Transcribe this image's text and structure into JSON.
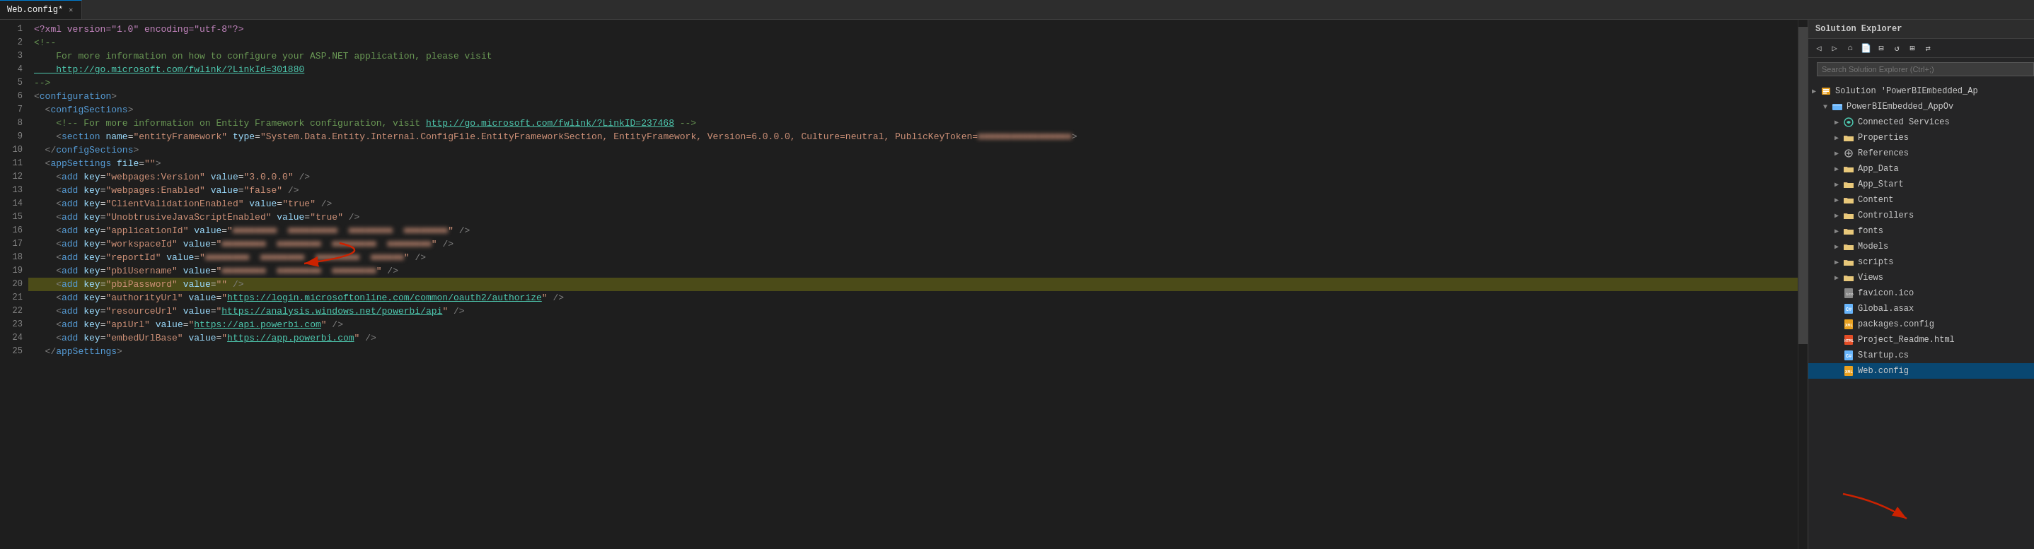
{
  "tab": {
    "label": "Web.config*",
    "modified": true
  },
  "editor": {
    "lines": [
      {
        "num": 1,
        "tokens": [
          {
            "t": "pi",
            "v": "<?xml version=\"1.0\" encoding=\"utf-8\"?>"
          }
        ]
      },
      {
        "num": 2,
        "tokens": [
          {
            "t": "comment",
            "v": "<!--"
          }
        ]
      },
      {
        "num": 3,
        "tokens": [
          {
            "t": "comment",
            "v": "    For more information on how to configure your ASP.NET application, please visit"
          }
        ]
      },
      {
        "num": 4,
        "tokens": [
          {
            "t": "link",
            "v": "    http://go.microsoft.com/fwlink/?LinkId=301880"
          }
        ]
      },
      {
        "num": 5,
        "tokens": [
          {
            "t": "comment",
            "v": "-->"
          }
        ]
      },
      {
        "num": 6,
        "tokens": [
          {
            "t": "bracket",
            "v": "<"
          },
          {
            "t": "tag",
            "v": "configuration"
          },
          {
            "t": "bracket",
            "v": ">"
          }
        ]
      },
      {
        "num": 7,
        "tokens": [
          {
            "t": "bracket",
            "v": "  <"
          },
          {
            "t": "tag",
            "v": "configSections"
          },
          {
            "t": "bracket",
            "v": ">"
          }
        ]
      },
      {
        "num": 8,
        "tokens": [
          {
            "t": "comment",
            "v": "    <!-- For more information on Entity Framework configuration, visit "
          },
          {
            "t": "link",
            "v": "http://go.microsoft.com/fwlink/?LinkID=237468"
          },
          {
            "t": "comment",
            "v": " -->"
          }
        ]
      },
      {
        "num": 9,
        "tokens": [
          {
            "t": "bracket",
            "v": "    <"
          },
          {
            "t": "tag",
            "v": "section"
          },
          {
            "t": "attr",
            "v": " name"
          },
          {
            "t": "eq",
            "v": "="
          },
          {
            "t": "val",
            "v": "\"entityFramework\""
          },
          {
            "t": "attr",
            "v": " type"
          },
          {
            "t": "eq",
            "v": "="
          },
          {
            "t": "val",
            "v": "\"System.Data.Entity.Internal.ConfigFile.EntityFrameworkSection, EntityFramework, Version=6.0.0.0, Culture=neutral, PublicKeyToken="
          },
          {
            "t": "blurred",
            "v": "■■■■■■■■■■■■■■■■■"
          },
          {
            "t": "bracket",
            "v": ">"
          }
        ]
      },
      {
        "num": 10,
        "tokens": [
          {
            "t": "bracket",
            "v": "  </"
          },
          {
            "t": "tag",
            "v": "configSections"
          },
          {
            "t": "bracket",
            "v": ">"
          }
        ]
      },
      {
        "num": 11,
        "tokens": [
          {
            "t": "bracket",
            "v": "  <"
          },
          {
            "t": "tag",
            "v": "appSettings"
          },
          {
            "t": "attr",
            "v": " file"
          },
          {
            "t": "eq",
            "v": "="
          },
          {
            "t": "val",
            "v": "\"\""
          },
          {
            "t": "bracket",
            "v": ">"
          }
        ]
      },
      {
        "num": 12,
        "tokens": [
          {
            "t": "bracket",
            "v": "    <"
          },
          {
            "t": "tag",
            "v": "add"
          },
          {
            "t": "attr",
            "v": " key"
          },
          {
            "t": "eq",
            "v": "="
          },
          {
            "t": "val",
            "v": "\"webpages:Version\""
          },
          {
            "t": "attr",
            "v": " value"
          },
          {
            "t": "eq",
            "v": "="
          },
          {
            "t": "val",
            "v": "\"3.0.0.0\""
          },
          {
            "t": "bracket",
            "v": " />"
          }
        ]
      },
      {
        "num": 13,
        "tokens": [
          {
            "t": "bracket",
            "v": "    <"
          },
          {
            "t": "tag",
            "v": "add"
          },
          {
            "t": "attr",
            "v": " key"
          },
          {
            "t": "eq",
            "v": "="
          },
          {
            "t": "val",
            "v": "\"webpages:Enabled\""
          },
          {
            "t": "attr",
            "v": " value"
          },
          {
            "t": "eq",
            "v": "="
          },
          {
            "t": "val",
            "v": "\"false\""
          },
          {
            "t": "bracket",
            "v": " />"
          }
        ]
      },
      {
        "num": 14,
        "tokens": [
          {
            "t": "bracket",
            "v": "    <"
          },
          {
            "t": "tag",
            "v": "add"
          },
          {
            "t": "attr",
            "v": " key"
          },
          {
            "t": "eq",
            "v": "="
          },
          {
            "t": "val",
            "v": "\"ClientValidationEnabled\""
          },
          {
            "t": "attr",
            "v": " value"
          },
          {
            "t": "eq",
            "v": "="
          },
          {
            "t": "val",
            "v": "\"true\""
          },
          {
            "t": "bracket",
            "v": " />"
          }
        ]
      },
      {
        "num": 15,
        "tokens": [
          {
            "t": "bracket",
            "v": "    <"
          },
          {
            "t": "tag",
            "v": "add"
          },
          {
            "t": "attr",
            "v": " key"
          },
          {
            "t": "eq",
            "v": "="
          },
          {
            "t": "val",
            "v": "\"UnobtrusiveJavaScriptEnabled\""
          },
          {
            "t": "attr",
            "v": " value"
          },
          {
            "t": "eq",
            "v": "="
          },
          {
            "t": "val",
            "v": "\"true\""
          },
          {
            "t": "bracket",
            "v": " />"
          }
        ]
      },
      {
        "num": 16,
        "tokens": [
          {
            "t": "bracket",
            "v": "    <"
          },
          {
            "t": "tag",
            "v": "add"
          },
          {
            "t": "attr",
            "v": " key"
          },
          {
            "t": "eq",
            "v": "="
          },
          {
            "t": "val",
            "v": "\"applicationId\""
          },
          {
            "t": "attr",
            "v": " value"
          },
          {
            "t": "eq",
            "v": "="
          },
          {
            "t": "val",
            "v": "\""
          },
          {
            "t": "blurred",
            "v": "■■■■■■■■  ■■■■■■■■■  ■■■■■■■■  ■■■■■■■■"
          },
          {
            "t": "val",
            "v": "\""
          },
          {
            "t": "bracket",
            "v": " />"
          }
        ]
      },
      {
        "num": 17,
        "tokens": [
          {
            "t": "bracket",
            "v": "    <"
          },
          {
            "t": "tag",
            "v": "add"
          },
          {
            "t": "attr",
            "v": " key"
          },
          {
            "t": "eq",
            "v": "="
          },
          {
            "t": "val",
            "v": "\"workspaceId\""
          },
          {
            "t": "attr",
            "v": " value"
          },
          {
            "t": "eq",
            "v": "="
          },
          {
            "t": "val",
            "v": "\""
          },
          {
            "t": "blurred",
            "v": "■■■■■■■■  ■■■■■■■■  ■■■■■■■■  ■■■■■■■■"
          },
          {
            "t": "val",
            "v": "\""
          },
          {
            "t": "bracket",
            "v": " />"
          }
        ]
      },
      {
        "num": 18,
        "tokens": [
          {
            "t": "bracket",
            "v": "    <"
          },
          {
            "t": "tag",
            "v": "add"
          },
          {
            "t": "attr",
            "v": " key"
          },
          {
            "t": "eq",
            "v": "="
          },
          {
            "t": "val",
            "v": "\"reportId\""
          },
          {
            "t": "attr",
            "v": " value"
          },
          {
            "t": "eq",
            "v": "="
          },
          {
            "t": "val",
            "v": "\""
          },
          {
            "t": "blurred",
            "v": "■■■■■■■■  ■■■■■■■■  ■■■■■■■■  ■■■■■■"
          },
          {
            "t": "val",
            "v": "\""
          },
          {
            "t": "bracket",
            "v": " />"
          }
        ]
      },
      {
        "num": 19,
        "tokens": [
          {
            "t": "bracket",
            "v": "    <"
          },
          {
            "t": "tag",
            "v": "add"
          },
          {
            "t": "attr",
            "v": " key"
          },
          {
            "t": "eq",
            "v": "="
          },
          {
            "t": "val",
            "v": "\"pbiUsername\""
          },
          {
            "t": "attr",
            "v": " value"
          },
          {
            "t": "eq",
            "v": "="
          },
          {
            "t": "val",
            "v": "\""
          },
          {
            "t": "blurred",
            "v": "■■■■■■■■  ■■■■■■■■  ■■■■■■■■"
          },
          {
            "t": "val",
            "v": "\""
          },
          {
            "t": "bracket",
            "v": " />"
          }
        ]
      },
      {
        "num": 20,
        "tokens": [
          {
            "t": "bracket",
            "v": "    <"
          },
          {
            "t": "tag",
            "v": "add"
          },
          {
            "t": "attr",
            "v": " key"
          },
          {
            "t": "eq",
            "v": "="
          },
          {
            "t": "val",
            "v": "\"pbiPassword\""
          },
          {
            "t": "attr",
            "v": " value"
          },
          {
            "t": "eq",
            "v": "="
          },
          {
            "t": "val",
            "v": "\"\""
          },
          {
            "t": "bracket",
            "v": " />"
          }
        ],
        "yellow": true
      },
      {
        "num": 21,
        "tokens": [
          {
            "t": "bracket",
            "v": "    <"
          },
          {
            "t": "tag",
            "v": "add"
          },
          {
            "t": "attr",
            "v": " key"
          },
          {
            "t": "eq",
            "v": "="
          },
          {
            "t": "val",
            "v": "\"authorityUrl\""
          },
          {
            "t": "attr",
            "v": " value"
          },
          {
            "t": "eq",
            "v": "="
          },
          {
            "t": "val",
            "v": "\""
          },
          {
            "t": "link",
            "v": "https://login.microsoftonline.com/common/oauth2/authorize"
          },
          {
            "t": "val",
            "v": "\""
          },
          {
            "t": "bracket",
            "v": " />"
          }
        ]
      },
      {
        "num": 22,
        "tokens": [
          {
            "t": "bracket",
            "v": "    <"
          },
          {
            "t": "tag",
            "v": "add"
          },
          {
            "t": "attr",
            "v": " key"
          },
          {
            "t": "eq",
            "v": "="
          },
          {
            "t": "val",
            "v": "\"resourceUrl\""
          },
          {
            "t": "attr",
            "v": " value"
          },
          {
            "t": "eq",
            "v": "="
          },
          {
            "t": "val",
            "v": "\""
          },
          {
            "t": "link",
            "v": "https://analysis.windows.net/powerbi/api"
          },
          {
            "t": "val",
            "v": "\""
          },
          {
            "t": "bracket",
            "v": " />"
          }
        ]
      },
      {
        "num": 23,
        "tokens": [
          {
            "t": "bracket",
            "v": "    <"
          },
          {
            "t": "tag",
            "v": "add"
          },
          {
            "t": "attr",
            "v": " key"
          },
          {
            "t": "eq",
            "v": "="
          },
          {
            "t": "val",
            "v": "\"apiUrl\""
          },
          {
            "t": "attr",
            "v": " value"
          },
          {
            "t": "eq",
            "v": "="
          },
          {
            "t": "val",
            "v": "\""
          },
          {
            "t": "link",
            "v": "https://api.powerbi.com"
          },
          {
            "t": "val",
            "v": "\""
          },
          {
            "t": "bracket",
            "v": " />"
          }
        ]
      },
      {
        "num": 24,
        "tokens": [
          {
            "t": "bracket",
            "v": "    <"
          },
          {
            "t": "tag",
            "v": "add"
          },
          {
            "t": "attr",
            "v": " key"
          },
          {
            "t": "eq",
            "v": "="
          },
          {
            "t": "val",
            "v": "\"embedUrlBase\""
          },
          {
            "t": "attr",
            "v": " value"
          },
          {
            "t": "eq",
            "v": "="
          },
          {
            "t": "val",
            "v": "\""
          },
          {
            "t": "link",
            "v": "https://app.powerbi.com"
          },
          {
            "t": "val",
            "v": "\""
          },
          {
            "t": "bracket",
            "v": " />"
          }
        ]
      },
      {
        "num": 25,
        "tokens": [
          {
            "t": "bracket",
            "v": "  </"
          },
          {
            "t": "tag",
            "v": "appSettings"
          },
          {
            "t": "bracket",
            "v": ">"
          }
        ]
      }
    ]
  },
  "solution_explorer": {
    "title": "Solution Explorer",
    "search_placeholder": "Search Solution Explorer (Ctrl+;)",
    "toolbar_buttons": [
      "back",
      "forward",
      "home",
      "collapse",
      "expand",
      "refresh",
      "sync"
    ],
    "tree": [
      {
        "level": 0,
        "expanded": false,
        "type": "solution",
        "label": "Solution 'PowerBIEmbedded_Ap",
        "icon": "solution"
      },
      {
        "level": 1,
        "expanded": true,
        "type": "project",
        "label": "PowerBIEmbedded_AppOv",
        "icon": "project"
      },
      {
        "level": 2,
        "expanded": false,
        "type": "folder",
        "label": "Connected Services",
        "icon": "connected"
      },
      {
        "level": 2,
        "expanded": false,
        "type": "folder",
        "label": "Properties",
        "icon": "folder"
      },
      {
        "level": 2,
        "expanded": false,
        "type": "folder",
        "label": "References",
        "icon": "ref"
      },
      {
        "level": 2,
        "expanded": false,
        "type": "folder",
        "label": "App_Data",
        "icon": "folder"
      },
      {
        "level": 2,
        "expanded": false,
        "type": "folder",
        "label": "App_Start",
        "icon": "folder"
      },
      {
        "level": 2,
        "expanded": false,
        "type": "folder",
        "label": "Content",
        "icon": "folder"
      },
      {
        "level": 2,
        "expanded": false,
        "type": "folder",
        "label": "Controllers",
        "icon": "folder"
      },
      {
        "level": 2,
        "expanded": false,
        "type": "folder",
        "label": "fonts",
        "icon": "folder"
      },
      {
        "level": 2,
        "expanded": false,
        "type": "folder",
        "label": "Models",
        "icon": "folder"
      },
      {
        "level": 2,
        "expanded": false,
        "type": "folder",
        "label": "scripts",
        "icon": "folder"
      },
      {
        "level": 2,
        "expanded": false,
        "type": "folder",
        "label": "Views",
        "icon": "folder"
      },
      {
        "level": 2,
        "expanded": false,
        "type": "ico",
        "label": "favicon.ico",
        "icon": "ico"
      },
      {
        "level": 2,
        "expanded": false,
        "type": "cs",
        "label": "Global.asax",
        "icon": "cs"
      },
      {
        "level": 2,
        "expanded": false,
        "type": "config",
        "label": "packages.config",
        "icon": "config"
      },
      {
        "level": 2,
        "expanded": false,
        "type": "html",
        "label": "Project_Readme.html",
        "icon": "html"
      },
      {
        "level": 2,
        "expanded": false,
        "type": "cs",
        "label": "Startup.cs",
        "icon": "cs"
      },
      {
        "level": 2,
        "expanded": false,
        "type": "config",
        "label": "Web.config",
        "icon": "config",
        "selected": true
      }
    ]
  }
}
